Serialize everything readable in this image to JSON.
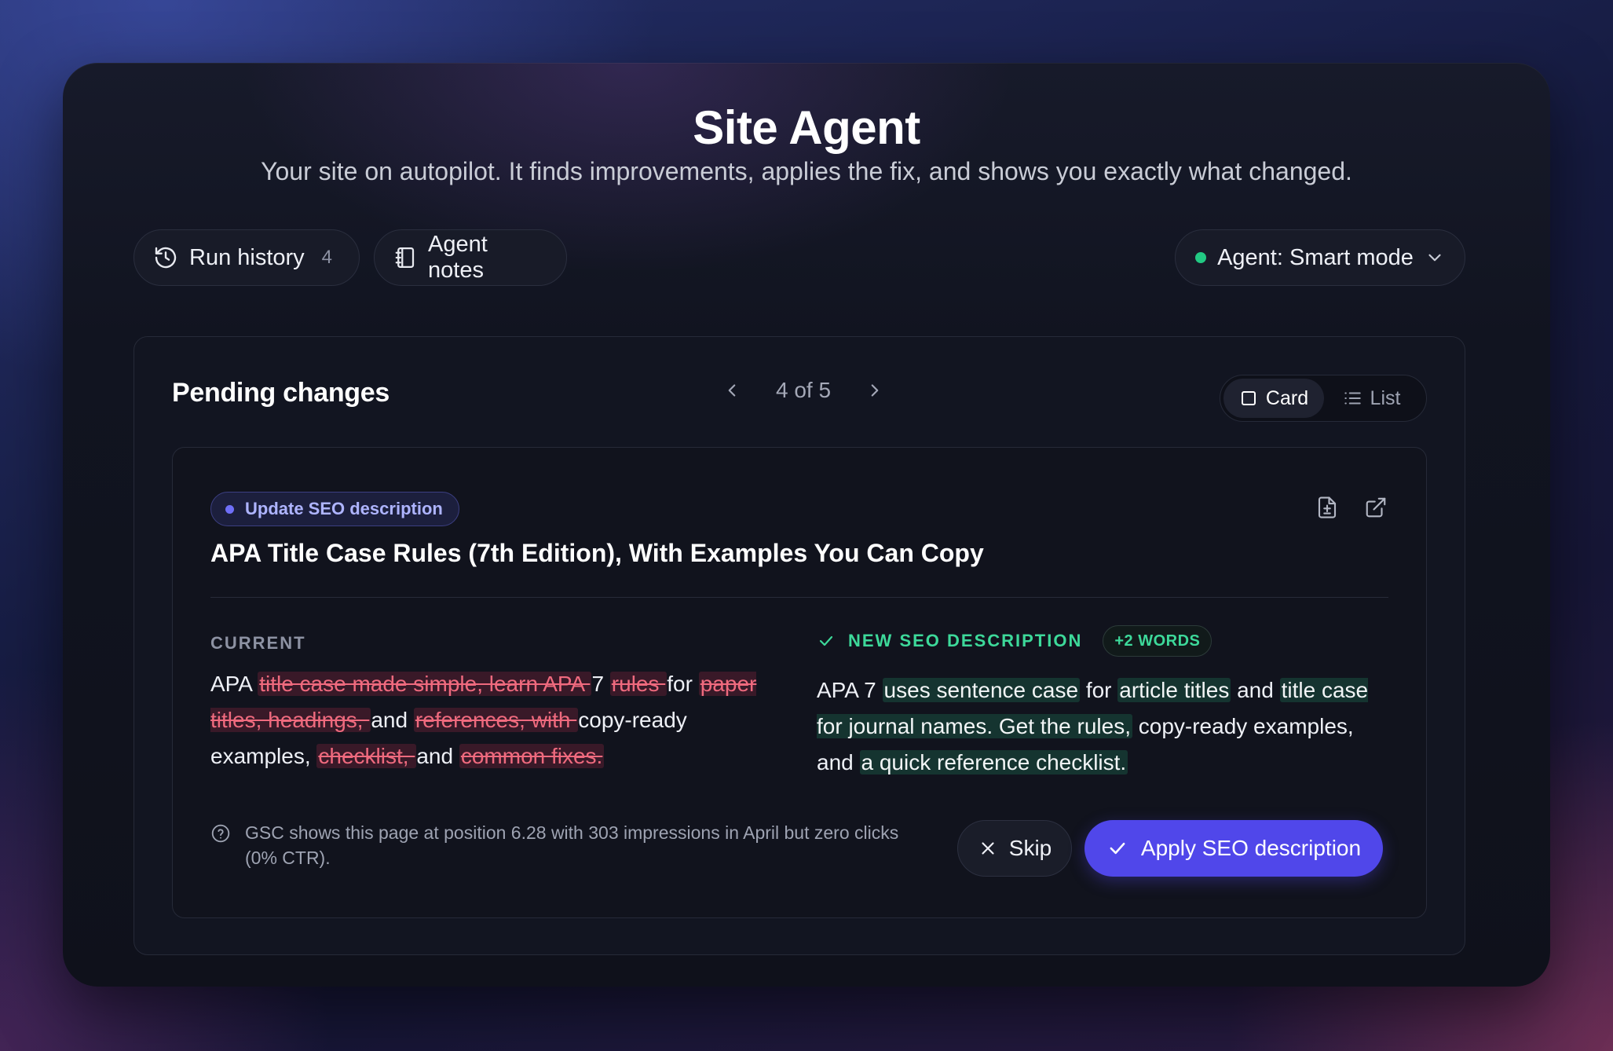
{
  "header": {
    "title": "Site Agent",
    "subtitle": "Your site on autopilot. It finds improvements, applies the fix, and shows you exactly what changed."
  },
  "toolbar": {
    "run_history_label": "Run history",
    "run_history_count": "4",
    "agent_notes_label": "Agent notes",
    "agent_mode_label": "Agent: Smart mode",
    "agent_status_color": "#22c983"
  },
  "pending": {
    "title": "Pending changes",
    "pager_text": "4 of 5",
    "view_card_label": "Card",
    "view_list_label": "List",
    "selected_view": "Card"
  },
  "change": {
    "tag_label": "Update SEO description",
    "page_title": "APA Title Case Rules (7th Edition), With Examples You Can Copy",
    "current_label": "CURRENT",
    "current_segments": [
      {
        "type": "same",
        "text": "APA "
      },
      {
        "type": "del",
        "text": "title case made simple, learn APA "
      },
      {
        "type": "same",
        "text": " 7 "
      },
      {
        "type": "del",
        "text": "rules "
      },
      {
        "type": "same",
        "text": " for "
      },
      {
        "type": "del",
        "text": "paper titles, headings, "
      },
      {
        "type": "same",
        "text": " and "
      },
      {
        "type": "del",
        "text": "references, with "
      },
      {
        "type": "same",
        "text": " copy-ready examples, "
      },
      {
        "type": "del",
        "text": "checklist, "
      },
      {
        "type": "same",
        "text": " and "
      },
      {
        "type": "del",
        "text": "common fixes."
      }
    ],
    "new_label": "NEW SEO DESCRIPTION",
    "words_badge": "+2 WORDS",
    "new_segments": [
      {
        "type": "same",
        "text": "APA 7 "
      },
      {
        "type": "ins",
        "text": "uses sentence case"
      },
      {
        "type": "same",
        "text": " for "
      },
      {
        "type": "ins",
        "text": "article titles"
      },
      {
        "type": "same",
        "text": " and "
      },
      {
        "type": "ins",
        "text": "title case for journal names. Get the rules,"
      },
      {
        "type": "same",
        "text": " copy-ready examples, and "
      },
      {
        "type": "ins",
        "text": "a quick reference checklist."
      }
    ],
    "note": "GSC shows this page at position 6.28 with 303 impressions in April but zero clicks (0% CTR).",
    "skip_label": "Skip",
    "apply_label": "Apply SEO description",
    "accent_color": "#5047ea"
  }
}
